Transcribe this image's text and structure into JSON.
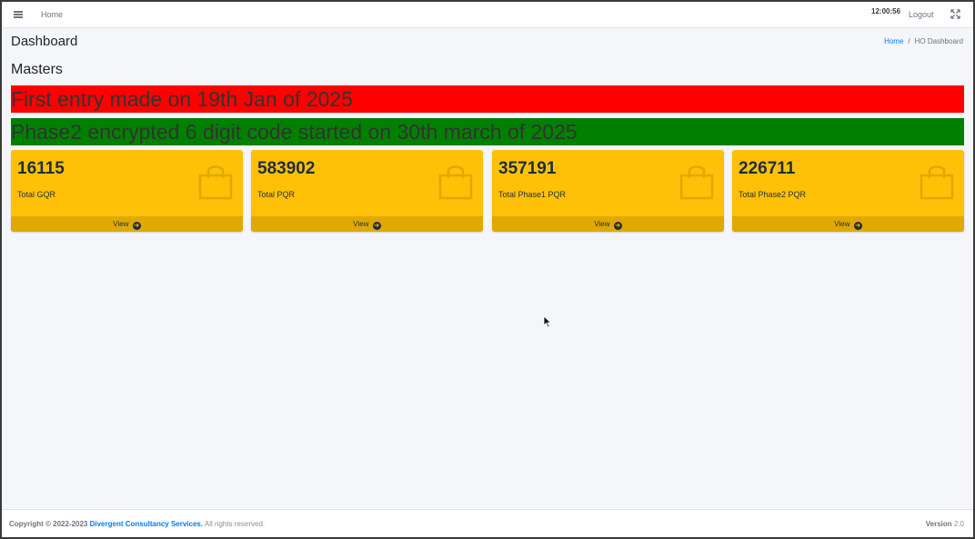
{
  "navbar": {
    "menu_icon": "hamburger-icon",
    "home_label": "Home",
    "time": "12:00:56",
    "logout_label": "Logout",
    "expand_icon": "fullscreen-icon"
  },
  "header": {
    "page_title": "Dashboard",
    "breadcrumb": {
      "home": "Home",
      "separator": "/",
      "current": "HO Dashboard"
    }
  },
  "section": {
    "title": "Masters"
  },
  "banners": [
    {
      "text": "First entry made on 19th Jan of 2025",
      "color": "#ff0000"
    },
    {
      "text": "Phase2 encrypted 6 digit code started on 30th march of 2025",
      "color": "#008000"
    }
  ],
  "cards": [
    {
      "value": "16115",
      "label": "Total GQR",
      "footer": "View",
      "icon": "shopping-bag-icon"
    },
    {
      "value": "583902",
      "label": "Total PQR",
      "footer": "View",
      "icon": "shopping-bag-icon"
    },
    {
      "value": "357191",
      "label": "Total Phase1 PQR",
      "footer": "View",
      "icon": "shopping-bag-icon"
    },
    {
      "value": "226711",
      "label": "Total Phase2 PQR",
      "footer": "View",
      "icon": "shopping-bag-icon"
    }
  ],
  "colors": {
    "card_bg": "#ffc107",
    "card_footer_bg": "#e0a800",
    "link": "#007bff"
  },
  "footer": {
    "copyright_prefix": "Copyright © 2022-2023",
    "company": "Divergent Consultancy Services.",
    "rights": "All rights reserved.",
    "version_label": "Version",
    "version_value": "2.0"
  }
}
